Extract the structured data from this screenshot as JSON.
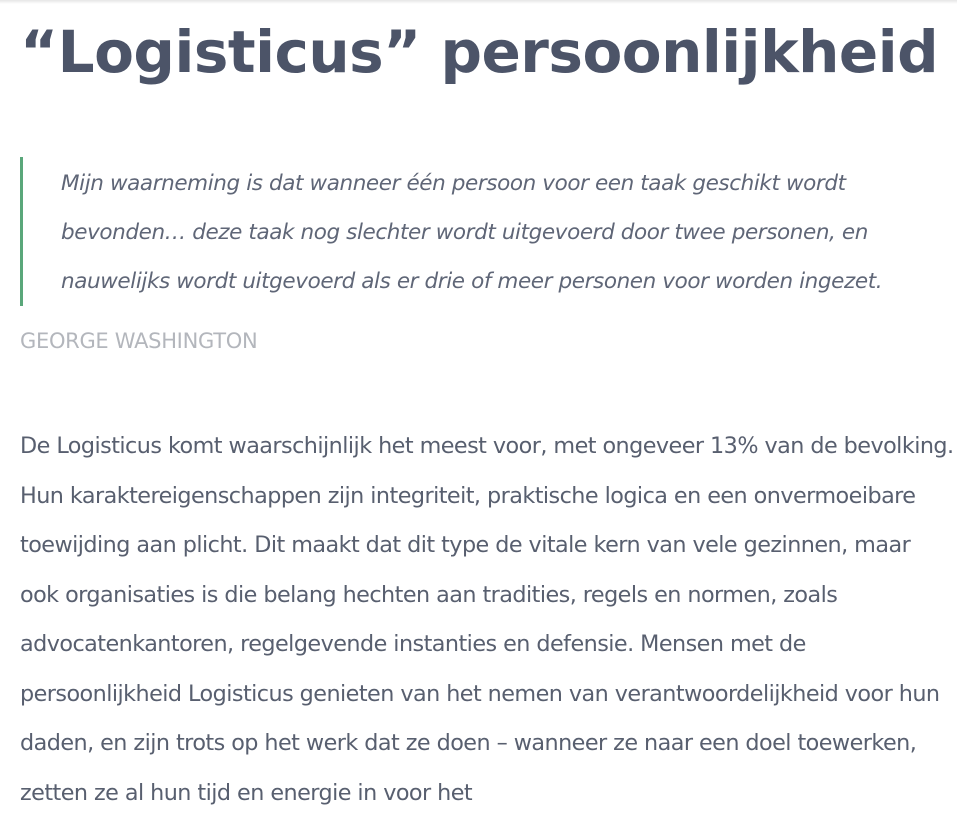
{
  "article": {
    "title": "“Logisticus” persoonlijkheid",
    "quote": {
      "text": "Mijn waarneming is dat wanneer één persoon voor een taak geschikt wordt bevonden… deze taak nog slechter wordt uitgevoerd door twee personen, en nauwelijks wordt uitgevoerd als er drie of meer personen voor worden ingezet.",
      "author": "GEORGE WASHINGTON"
    },
    "paragraph": "De Logisticus komt waarschijnlijk het meest voor, met ongeveer 13% van de bevolking. Hun karaktereigenschappen zijn integriteit, praktische logica en een onvermoeibare toewijding aan plicht. Dit maakt dat dit type de vitale kern van vele gezinnen, maar ook organisaties is die belang hechten aan tradities, regels en normen, zoals advocatenkantoren, regelgevende instanties en defensie. Mensen met de persoonlijkheid Logisticus genieten van het nemen van verantwoordelijkheid voor hun daden, en zijn trots op het werk dat ze doen – wanneer ze naar een doel toewerken, zetten ze al hun tijd en energie in voor het"
  },
  "colors": {
    "title": "#4c5468",
    "quote_border": "#5aa77a",
    "author": "#b3b6bc",
    "body": "#585f6f"
  }
}
